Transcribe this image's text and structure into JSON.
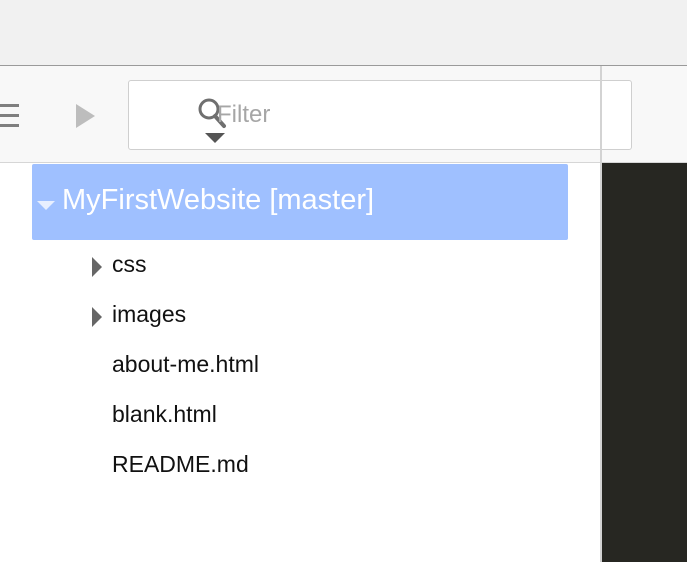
{
  "toolbar": {
    "menu_icon": "hamburger-menu-icon",
    "run_icon": "play-icon",
    "filter": {
      "placeholder": "Filter",
      "value": "",
      "icon": "search-icon"
    }
  },
  "tree": {
    "root": {
      "label": "MyFirstWebsite [master]",
      "expanded": true
    },
    "items": [
      {
        "label": "css",
        "type": "folder",
        "expanded": false
      },
      {
        "label": "images",
        "type": "folder",
        "expanded": false
      },
      {
        "label": "about-me.html",
        "type": "file"
      },
      {
        "label": "blank.html",
        "type": "file"
      },
      {
        "label": "README.md",
        "type": "file"
      }
    ]
  },
  "colors": {
    "selection": "#9fc0ff",
    "editor_background": "#272722",
    "toolbar_background": "#f8f8f8",
    "titlebar_background": "#f1f1f1"
  }
}
